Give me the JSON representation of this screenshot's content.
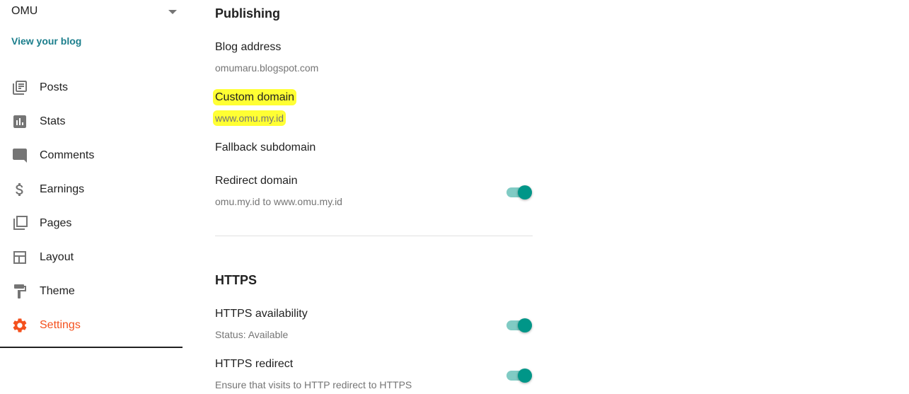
{
  "sidebar": {
    "blog_name": "OMU",
    "view_blog_label": "View your blog",
    "items": [
      {
        "label": "Posts",
        "icon": "posts-icon"
      },
      {
        "label": "Stats",
        "icon": "stats-icon"
      },
      {
        "label": "Comments",
        "icon": "comments-icon"
      },
      {
        "label": "Earnings",
        "icon": "dollar-icon"
      },
      {
        "label": "Pages",
        "icon": "pages-icon"
      },
      {
        "label": "Layout",
        "icon": "layout-icon"
      },
      {
        "label": "Theme",
        "icon": "paint-roller-icon"
      },
      {
        "label": "Settings",
        "icon": "gear-icon",
        "active": true
      }
    ]
  },
  "publishing": {
    "title": "Publishing",
    "blog_address": {
      "label": "Blog address",
      "value": "omumaru.blogspot.com"
    },
    "custom_domain": {
      "label": "Custom domain",
      "value": "www.omu.my.id"
    },
    "fallback_subdomain": {
      "label": "Fallback subdomain"
    },
    "redirect_domain": {
      "label": "Redirect domain",
      "value": "omu.my.id to www.omu.my.id",
      "enabled": true
    }
  },
  "https": {
    "title": "HTTPS",
    "availability": {
      "label": "HTTPS availability",
      "value": "Status: Available",
      "enabled": true
    },
    "redirect": {
      "label": "HTTPS redirect",
      "value": "Ensure that visits to HTTP redirect to HTTPS",
      "enabled": true
    }
  },
  "colors": {
    "accent_active": "#f4511e",
    "link": "#1b7e8c",
    "toggle_thumb": "#009688",
    "toggle_track": "#80cbc4",
    "highlight": "#ffff33",
    "icon_gray": "#757575"
  }
}
